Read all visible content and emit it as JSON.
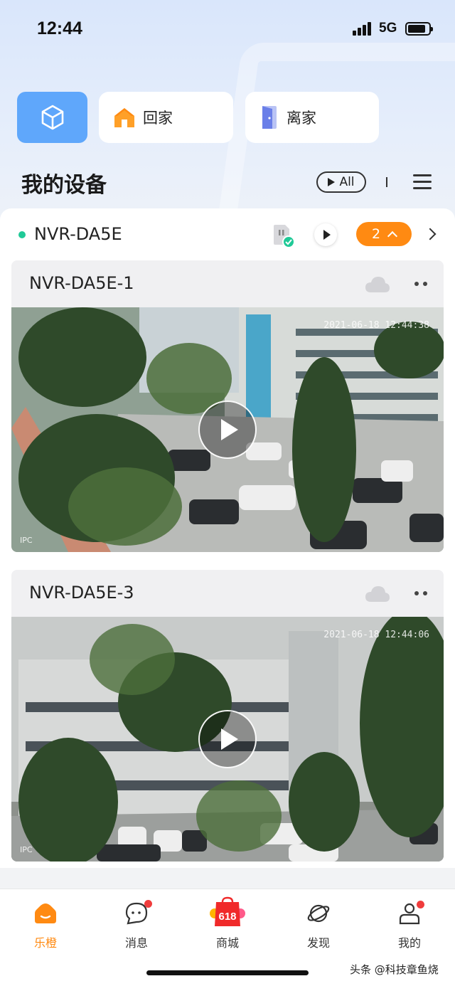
{
  "status_bar": {
    "time": "12:44",
    "network": "5G",
    "battery_level": 0.85
  },
  "scenes": [
    {
      "label": "回家",
      "icon": "house-icon"
    },
    {
      "label": "离家",
      "icon": "door-icon"
    }
  ],
  "scene_cube_icon": "cube-icon",
  "section": {
    "title": "我的设备",
    "all_label": "All"
  },
  "device": {
    "name": "NVR-DA5E",
    "status_color": "#20c997",
    "channel_count": "2",
    "cameras": [
      {
        "name": "NVR-DA5E-1",
        "timestamp": "2021-06-18 12:44:38",
        "label": "IPC"
      },
      {
        "name": "NVR-DA5E-3",
        "timestamp": "2021-06-18 12:44:06",
        "label": "IPC"
      }
    ]
  },
  "tabs": [
    {
      "label": "乐橙",
      "icon": "lechange-home-icon",
      "active": true
    },
    {
      "label": "消息",
      "icon": "message-icon",
      "badge": true
    },
    {
      "label": "商城",
      "icon": "shop-618-icon",
      "badge_text": "618"
    },
    {
      "label": "发现",
      "icon": "planet-icon"
    },
    {
      "label": "我的",
      "icon": "profile-icon",
      "badge": true
    }
  ],
  "watermark": "头条 @科技章鱼烧",
  "colors": {
    "accent": "#ff8a12",
    "primary_blue": "#5fa7fb",
    "badge": "#f03c3c"
  }
}
